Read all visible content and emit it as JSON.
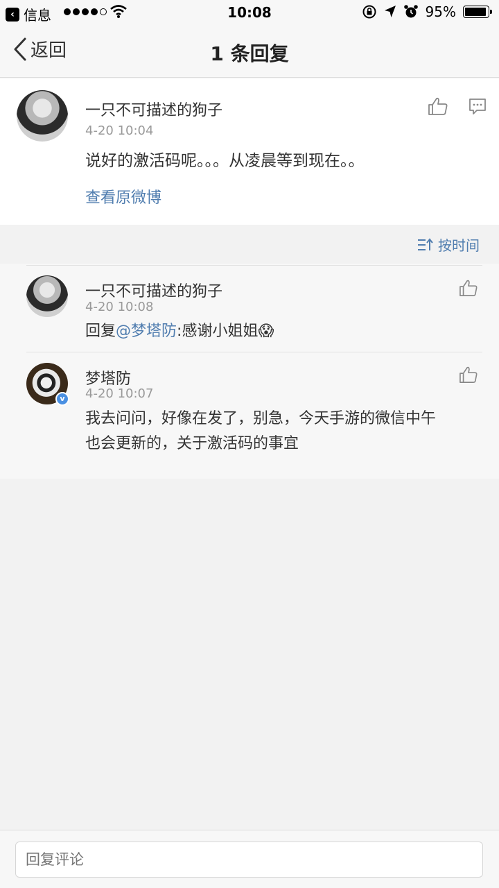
{
  "status_bar": {
    "back_app": "信息",
    "time": "10:08",
    "battery": "95%",
    "battery_level": 0.95
  },
  "nav": {
    "back_label": "返回",
    "title": "1 条回复"
  },
  "main_comment": {
    "author": "一只不可描述的狗子",
    "time": "4-20 10:04",
    "text": "说好的激活码呢。。。从凌晨等到现在。。",
    "view_original": "查看原微博"
  },
  "sort": {
    "label": "按时间"
  },
  "replies": [
    {
      "author": "一只不可描述的狗子",
      "time": "4-20 10:08",
      "prefix": "回复",
      "mention": "@梦塔防",
      "text": ":感谢小姐姐",
      "emoji": "😱"
    },
    {
      "author": "梦塔防",
      "time": "4-20 10:07",
      "text_line1": "我去问问，好像在发了，别急，今天手游的微信中午",
      "text_line2": "也会更新的，关于激活码的事宜",
      "verified_badge": "v"
    }
  ],
  "reply_input": {
    "placeholder": "回复评论"
  },
  "colors": {
    "link": "#507daf",
    "background": "#f2f2f2",
    "verified": "#4a90e2"
  }
}
